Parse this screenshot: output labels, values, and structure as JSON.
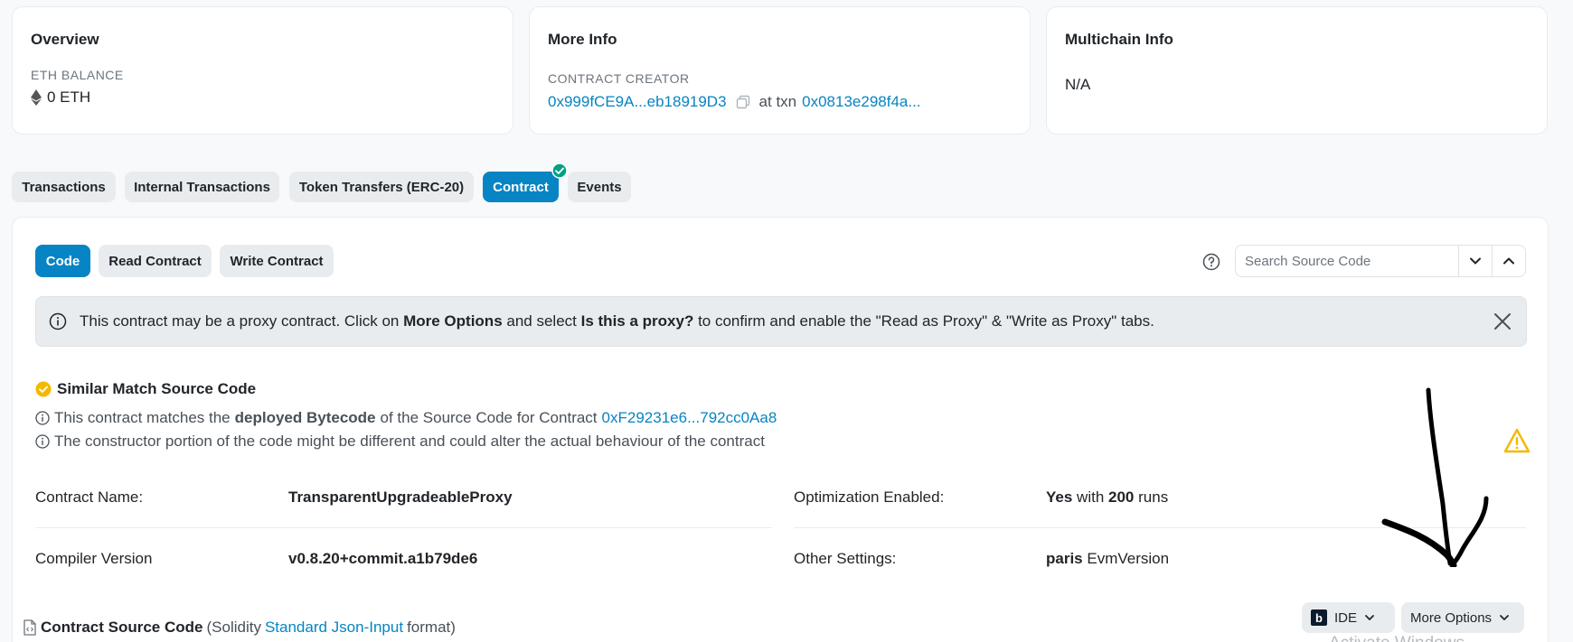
{
  "overview": {
    "title": "Overview",
    "balance_label": "ETH BALANCE",
    "balance_value": "0 ETH"
  },
  "more_info": {
    "title": "More Info",
    "creator_label": "CONTRACT CREATOR",
    "creator_address": "0x999fCE9A...eb18919D3",
    "at_txn": "at txn",
    "txn_hash": "0x0813e298f4a..."
  },
  "multichain": {
    "title": "Multichain Info",
    "value": "N/A"
  },
  "tabs": [
    {
      "label": "Transactions"
    },
    {
      "label": "Internal Transactions"
    },
    {
      "label": "Token Transfers (ERC-20)"
    },
    {
      "label": "Contract"
    },
    {
      "label": "Events"
    }
  ],
  "subtabs": [
    {
      "label": "Code"
    },
    {
      "label": "Read Contract"
    },
    {
      "label": "Write Contract"
    }
  ],
  "search": {
    "placeholder": "Search Source Code"
  },
  "alert": {
    "part1": "This contract may be a proxy contract. Click on",
    "bold1": "More Options",
    "part2": "and select",
    "bold2": "Is this a proxy?",
    "part3": "to confirm and enable the \"Read as Proxy\" & \"Write as Proxy\" tabs."
  },
  "match": {
    "title": "Similar Match Source Code",
    "line1_a": "This contract matches the",
    "line1_bold": "deployed Bytecode",
    "line1_b": "of the Source Code for Contract",
    "line1_link": "0xF29231e6...792cc0Aa8",
    "line2": "The constructor portion of the code might be different and could alter the actual behaviour of the contract"
  },
  "details": {
    "contract_name_label": "Contract Name:",
    "contract_name": "TransparentUpgradeableProxy",
    "compiler_label": "Compiler Version",
    "compiler": "v0.8.20+commit.a1b79de6",
    "optimization_label": "Optimization Enabled:",
    "optimization_yes": "Yes",
    "optimization_with": "with",
    "optimization_runs_count": "200",
    "optimization_runs": "runs",
    "other_label": "Other Settings:",
    "other_bold": "paris",
    "other_rest": "EvmVersion"
  },
  "source": {
    "title": "Contract Source Code",
    "paren_open": "(Solidity",
    "link": "Standard Json-Input",
    "paren_close": "format)"
  },
  "buttons": {
    "ide_logo": "b",
    "ide": "IDE",
    "more_options": "More Options"
  },
  "watermark": "Activate Windows",
  "colors": {
    "accent": "#0784c3",
    "success": "#00a186",
    "warning": "#f5b800"
  }
}
